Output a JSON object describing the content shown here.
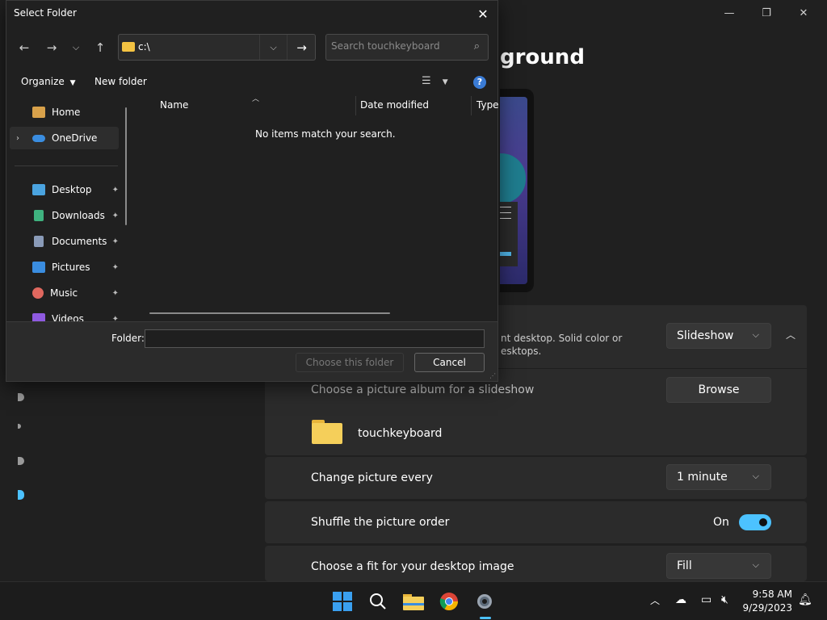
{
  "settings": {
    "title_partial": "ground",
    "background_row": {
      "description_line1": "nt desktop. Solid color or",
      "description_line2": "esktops.",
      "selected": "Slideshow"
    },
    "album_row": {
      "label": "Choose a picture album for a slideshow",
      "button": "Browse",
      "folder_name": "touchkeyboard"
    },
    "change_picture_row": {
      "label": "Change picture every",
      "selected": "1 minute"
    },
    "shuffle_row": {
      "label": "Shuffle the picture order",
      "state": "On"
    },
    "fit_row": {
      "label": "Choose a fit for your desktop image",
      "selected": "Fill"
    }
  },
  "dialog": {
    "title": "Select Folder",
    "address": "c:\\",
    "search_placeholder": "Search touchkeyboard",
    "toolbar": {
      "organize": "Organize",
      "new_folder": "New folder"
    },
    "nav_items": [
      {
        "label": "Home",
        "icon": "home-icon",
        "pinned": false,
        "color": "#d8a14a"
      },
      {
        "label": "OneDrive",
        "icon": "cloud-icon",
        "pinned": false,
        "selected": true,
        "color": "#3a8de0"
      },
      {
        "label": "Desktop",
        "icon": "desktop-icon",
        "pinned": true,
        "color": "#4aa3df"
      },
      {
        "label": "Downloads",
        "icon": "download-icon",
        "pinned": true,
        "color": "#3fb27f"
      },
      {
        "label": "Documents",
        "icon": "document-icon",
        "pinned": true,
        "color": "#8a9bb8"
      },
      {
        "label": "Pictures",
        "icon": "picture-icon",
        "pinned": true,
        "color": "#3a8de0"
      },
      {
        "label": "Music",
        "icon": "music-icon",
        "pinned": true,
        "color": "#e0685f"
      },
      {
        "label": "Videos",
        "icon": "video-icon",
        "pinned": true,
        "color": "#8f5ae0"
      }
    ],
    "columns": [
      "Name",
      "Date modified",
      "Type"
    ],
    "empty_message": "No items match your search.",
    "folder_label": "Folder:",
    "folder_value": "",
    "choose_button": "Choose this folder",
    "cancel_button": "Cancel"
  },
  "taskbar": {
    "time": "9:58 AM",
    "date": "9/29/2023",
    "accent": "#4cc2ff"
  }
}
